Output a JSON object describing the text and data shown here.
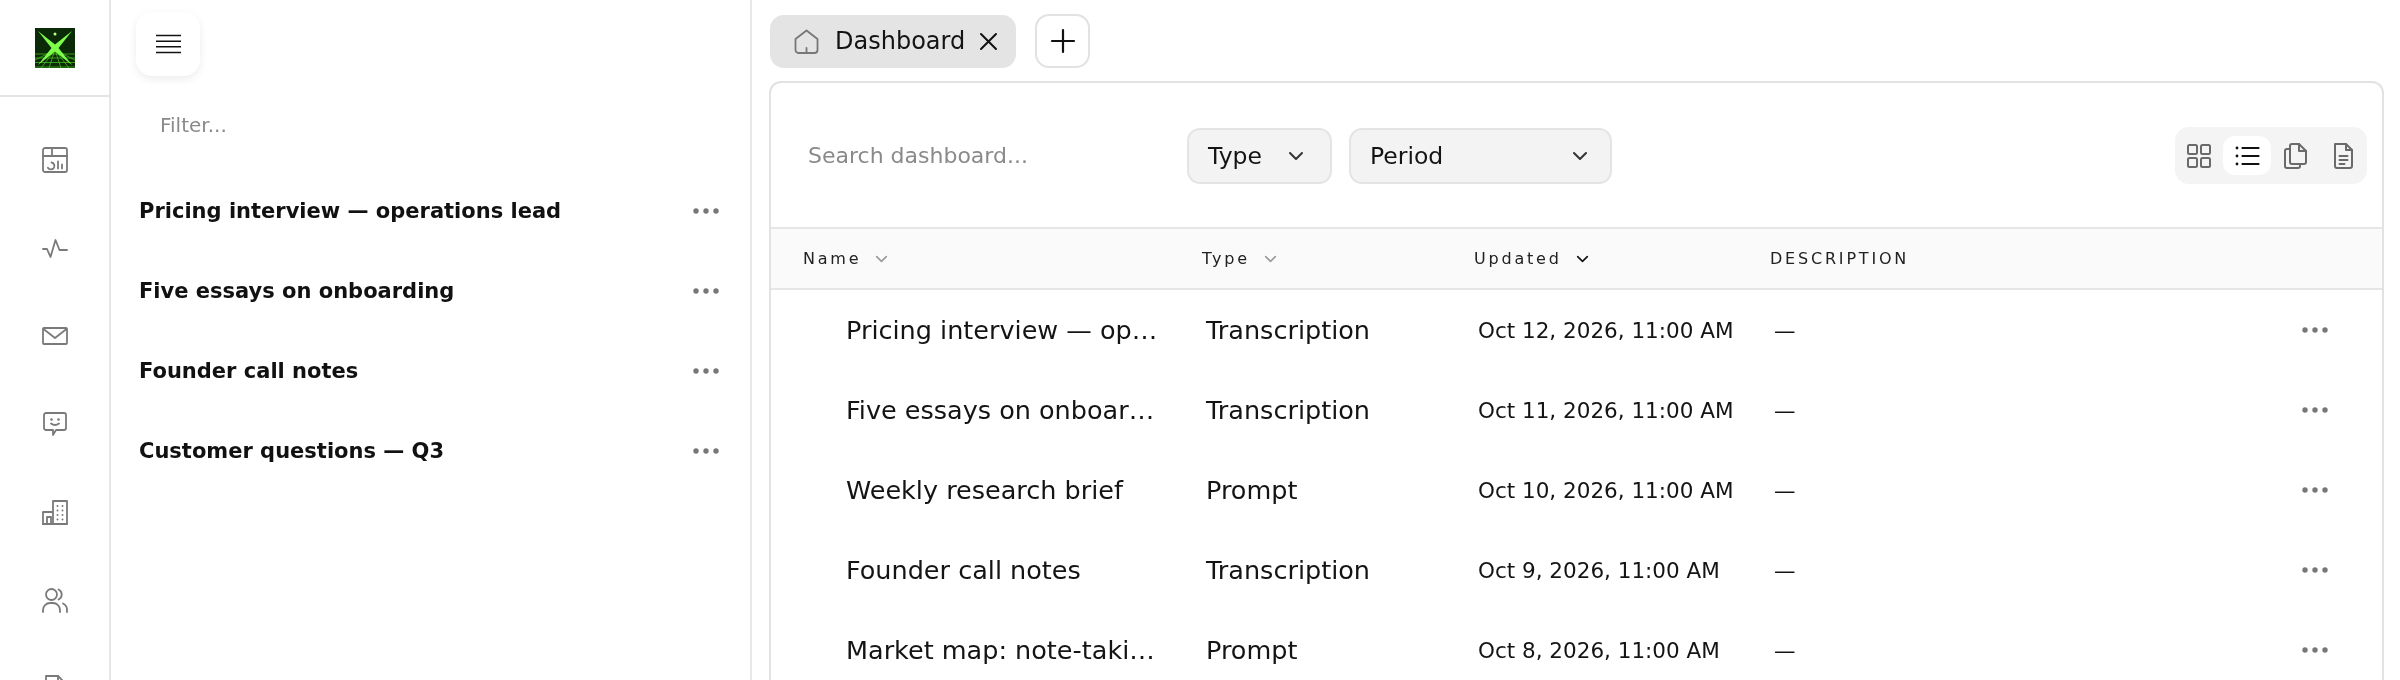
{
  "sidebar": {
    "filter": {
      "placeholder": "Filter..."
    },
    "items": [
      {
        "title": "Pricing interview — operations lead"
      },
      {
        "title": "Five essays on onboarding"
      },
      {
        "title": "Founder call notes"
      },
      {
        "title": "Customer questions — Q3"
      }
    ]
  },
  "tabs": [
    {
      "label": "Dashboard",
      "selected": true
    }
  ],
  "toolbar": {
    "search": {
      "placeholder": "Search dashboard..."
    },
    "filters": [
      {
        "label": "Type"
      },
      {
        "label": "Period"
      }
    ],
    "view_modes": [
      {
        "kind": "grid",
        "selected": false
      },
      {
        "kind": "list",
        "selected": true
      },
      {
        "kind": "pages",
        "selected": false
      },
      {
        "kind": "document",
        "selected": false
      }
    ]
  },
  "table": {
    "columns": [
      {
        "label": "Name",
        "sortable": true,
        "sorted": false
      },
      {
        "label": "Type",
        "sortable": true,
        "sorted": false
      },
      {
        "label": "Updated",
        "sortable": true,
        "sorted": true
      },
      {
        "label": "DESCRIPTION",
        "sortable": false,
        "sorted": false
      }
    ],
    "rows": [
      {
        "name": "Pricing interview — op…",
        "type": "Transcription",
        "updated": "Oct 12, 2026, 11:00 AM",
        "description": "—"
      },
      {
        "name": "Five essays on onboar…",
        "type": "Transcription",
        "updated": "Oct 11, 2026, 11:00 AM",
        "description": "—"
      },
      {
        "name": "Weekly research brief",
        "type": "Prompt",
        "updated": "Oct 10, 2026, 11:00 AM",
        "description": "—"
      },
      {
        "name": "Founder call notes",
        "type": "Transcription",
        "updated": "Oct 9, 2026, 11:00 AM",
        "description": "—"
      },
      {
        "name": "Market map: note-taki…",
        "type": "Prompt",
        "updated": "Oct 8, 2026, 11:00 AM",
        "description": "—"
      }
    ]
  }
}
